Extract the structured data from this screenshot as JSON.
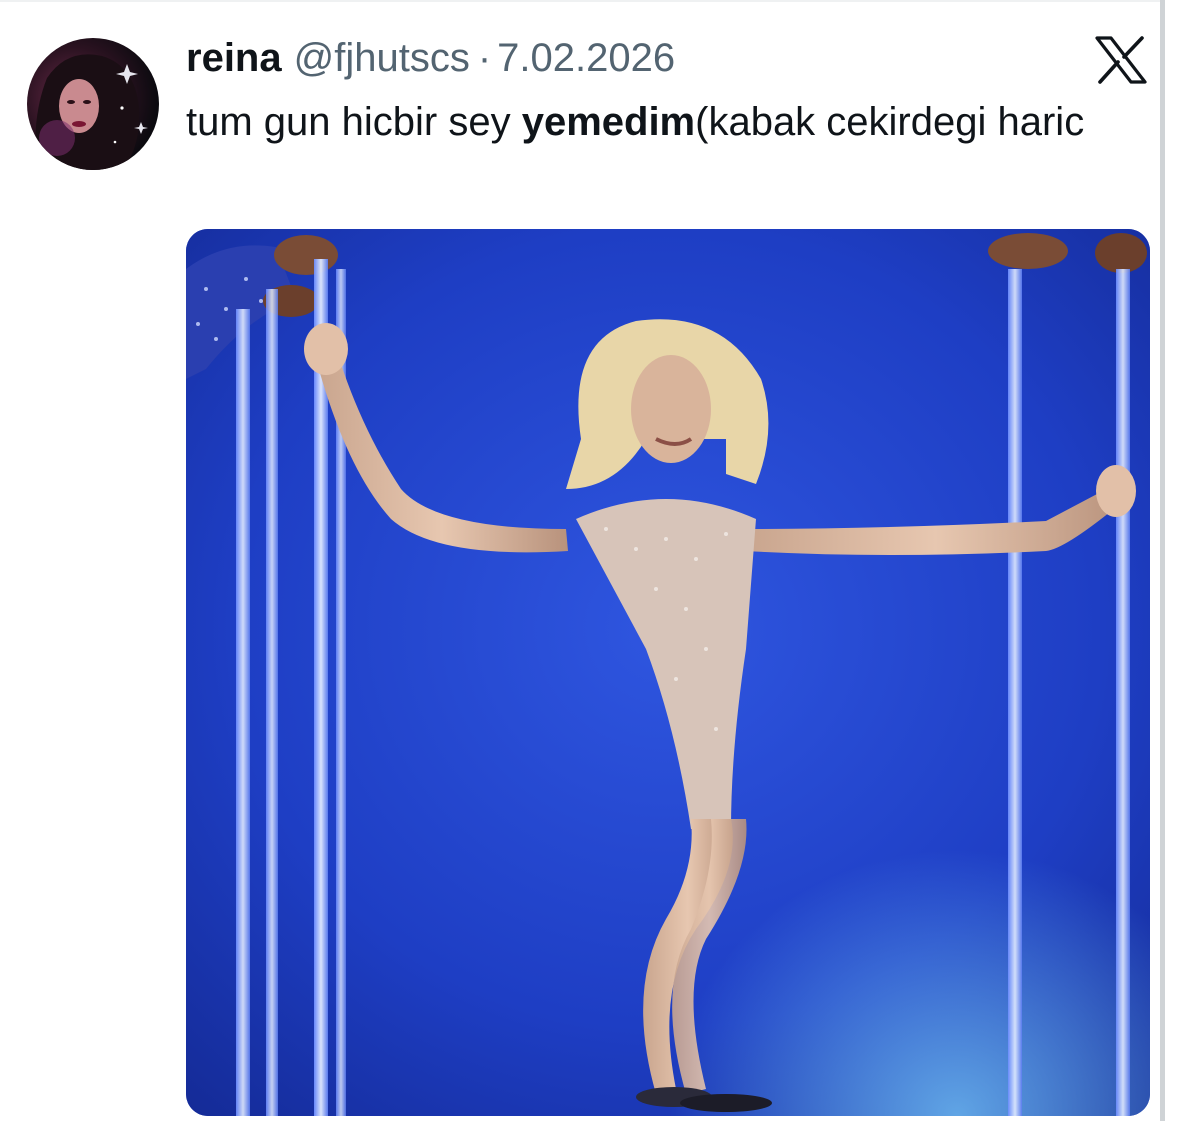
{
  "tweet": {
    "author_name": "reina",
    "author_handle": "@fjhutscs",
    "separator": "·",
    "date": "7.02.2026",
    "text_before": "tum gun hicbir sey ",
    "text_bold": "yemedim",
    "text_after": "(kabak cekirdegi haric"
  },
  "icons": {
    "platform": "x-logo-icon",
    "avatar": "profile-avatar-image",
    "media": "tweet-photo"
  },
  "colors": {
    "text": "#0f1419",
    "secondary_text": "#536471",
    "media_background": "#1f3fc4"
  }
}
